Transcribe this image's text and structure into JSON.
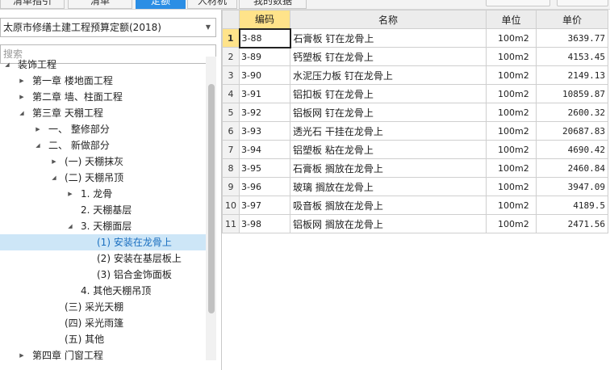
{
  "top_tabs": [
    {
      "label": "清单指引",
      "active": false
    },
    {
      "label": "清单",
      "active": false
    },
    {
      "label": "定额",
      "active": true
    },
    {
      "label": "人材机",
      "active": false
    },
    {
      "label": "我的数据",
      "active": false
    }
  ],
  "left": {
    "library_select": {
      "value": "太原市修缮土建工程预算定额(2018)"
    },
    "search": {
      "placeholder": "搜索"
    },
    "tree": [
      {
        "label": "装饰工程",
        "level": 0,
        "arrow": "expanded"
      },
      {
        "label": "第一章 楼地面工程",
        "level": 1,
        "arrow": "collapsed"
      },
      {
        "label": "第二章 墙、柱面工程",
        "level": 1,
        "arrow": "collapsed"
      },
      {
        "label": "第三章 天棚工程",
        "level": 1,
        "arrow": "expanded"
      },
      {
        "label": "一、 整修部分",
        "level": 2,
        "arrow": "collapsed"
      },
      {
        "label": "二、 新做部分",
        "level": 2,
        "arrow": "expanded"
      },
      {
        "label": "(一) 天棚抹灰",
        "level": 3,
        "arrow": "collapsed"
      },
      {
        "label": "(二) 天棚吊顶",
        "level": 3,
        "arrow": "expanded"
      },
      {
        "label": "1. 龙骨",
        "level": 4,
        "arrow": "collapsed"
      },
      {
        "label": "2. 天棚基层",
        "level": 4,
        "arrow": "none"
      },
      {
        "label": "3. 天棚面层",
        "level": 4,
        "arrow": "expanded"
      },
      {
        "label": "(1) 安装在龙骨上",
        "level": 5,
        "arrow": "none",
        "selected": true
      },
      {
        "label": "(2) 安装在基层板上",
        "level": 5,
        "arrow": "none"
      },
      {
        "label": "(3) 铝合金饰面板",
        "level": 5,
        "arrow": "none"
      },
      {
        "label": "4. 其他天棚吊顶",
        "level": 4,
        "arrow": "none"
      },
      {
        "label": "(三) 采光天棚",
        "level": 3,
        "arrow": "none"
      },
      {
        "label": "(四) 采光雨篷",
        "level": 3,
        "arrow": "none"
      },
      {
        "label": "(五) 其他",
        "level": 3,
        "arrow": "none"
      },
      {
        "label": "第四章 门窗工程",
        "level": 1,
        "arrow": "collapsed"
      }
    ]
  },
  "grid": {
    "columns": [
      "编码",
      "名称",
      "单位",
      "单价"
    ],
    "active_column": "编码",
    "rows": [
      {
        "num": "1",
        "code": "3-88",
        "name": "石膏板 钉在龙骨上",
        "unit": "100m2",
        "price": "3639.77",
        "current": true
      },
      {
        "num": "2",
        "code": "3-89",
        "name": "钙塑板 钉在龙骨上",
        "unit": "100m2",
        "price": "4153.45"
      },
      {
        "num": "3",
        "code": "3-90",
        "name": "水泥压力板 钉在龙骨上",
        "unit": "100m2",
        "price": "2149.13"
      },
      {
        "num": "4",
        "code": "3-91",
        "name": "铝扣板 钉在龙骨上",
        "unit": "100m2",
        "price": "10859.87"
      },
      {
        "num": "5",
        "code": "3-92",
        "name": "铝板网 钉在龙骨上",
        "unit": "100m2",
        "price": "2600.32"
      },
      {
        "num": "6",
        "code": "3-93",
        "name": "透光石 干挂在龙骨上",
        "unit": "100m2",
        "price": "20687.83"
      },
      {
        "num": "7",
        "code": "3-94",
        "name": "铝塑板 粘在龙骨上",
        "unit": "100m2",
        "price": "4690.42"
      },
      {
        "num": "8",
        "code": "3-95",
        "name": "石膏板 搁放在龙骨上",
        "unit": "100m2",
        "price": "2460.84"
      },
      {
        "num": "9",
        "code": "3-96",
        "name": "玻璃 搁放在龙骨上",
        "unit": "100m2",
        "price": "3947.09"
      },
      {
        "num": "10",
        "code": "3-97",
        "name": "吸音板 搁放在龙骨上",
        "unit": "100m2",
        "price": "4189.5"
      },
      {
        "num": "11",
        "code": "3-98",
        "name": "铝板网 搁放在龙骨上",
        "unit": "100m2",
        "price": "2471.56"
      }
    ]
  },
  "colors": {
    "accent": "#2b8ee5",
    "selected_tree_bg": "#cde6f7",
    "active_header": "#ffe38a"
  }
}
